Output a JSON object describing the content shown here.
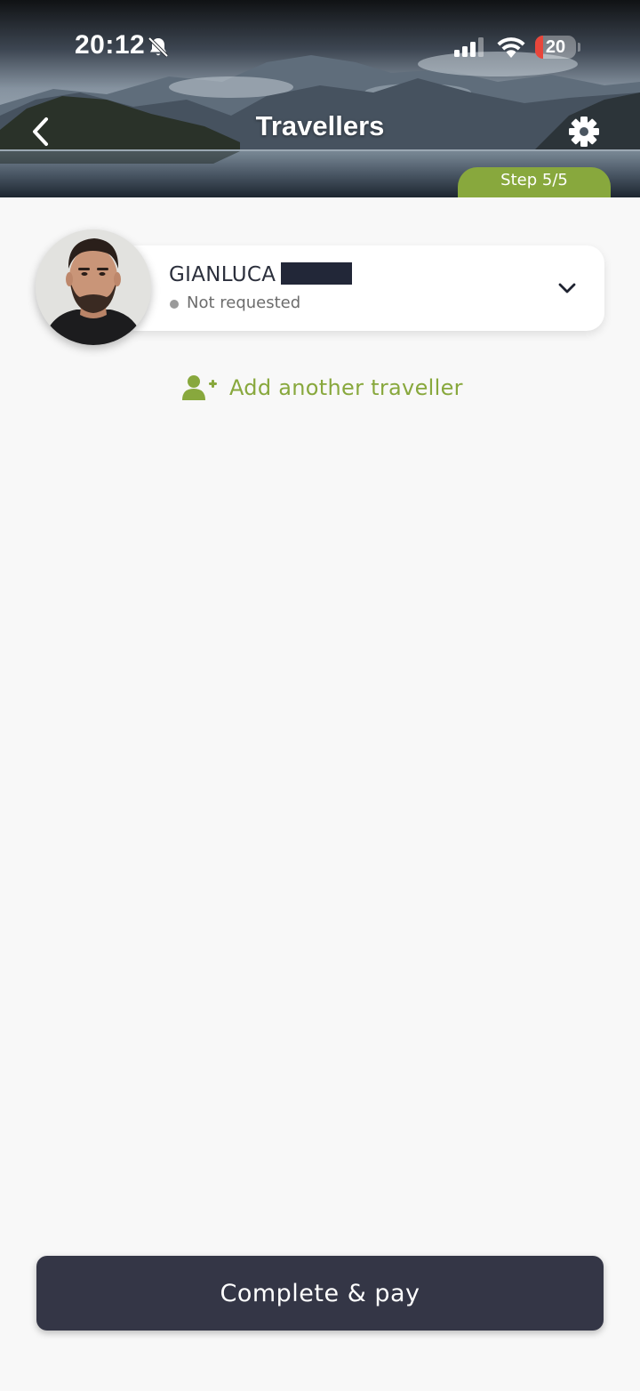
{
  "status_bar": {
    "time": "20:12",
    "battery": "20",
    "battery_level": 0.2
  },
  "header": {
    "title": "Travellers",
    "step": "Step 5/5"
  },
  "travellers": [
    {
      "name": "GIANLUCA",
      "status": "Not requested",
      "status_color": "#9a9a9a"
    }
  ],
  "actions": {
    "add_traveller_label": "Add another traveller",
    "complete_label": "Complete & pay"
  },
  "colors": {
    "accent": "#88a83d",
    "primary_button": "#343646",
    "low_battery": "#e8463b"
  },
  "icons": {
    "back": "chevron-left-icon",
    "settings": "gear-icon",
    "expand": "chevron-down-icon",
    "add_person": "user-plus-icon",
    "muted": "bell-slash-icon",
    "signal": "cellular-signal-icon",
    "wifi": "wifi-icon",
    "battery": "battery-icon"
  }
}
